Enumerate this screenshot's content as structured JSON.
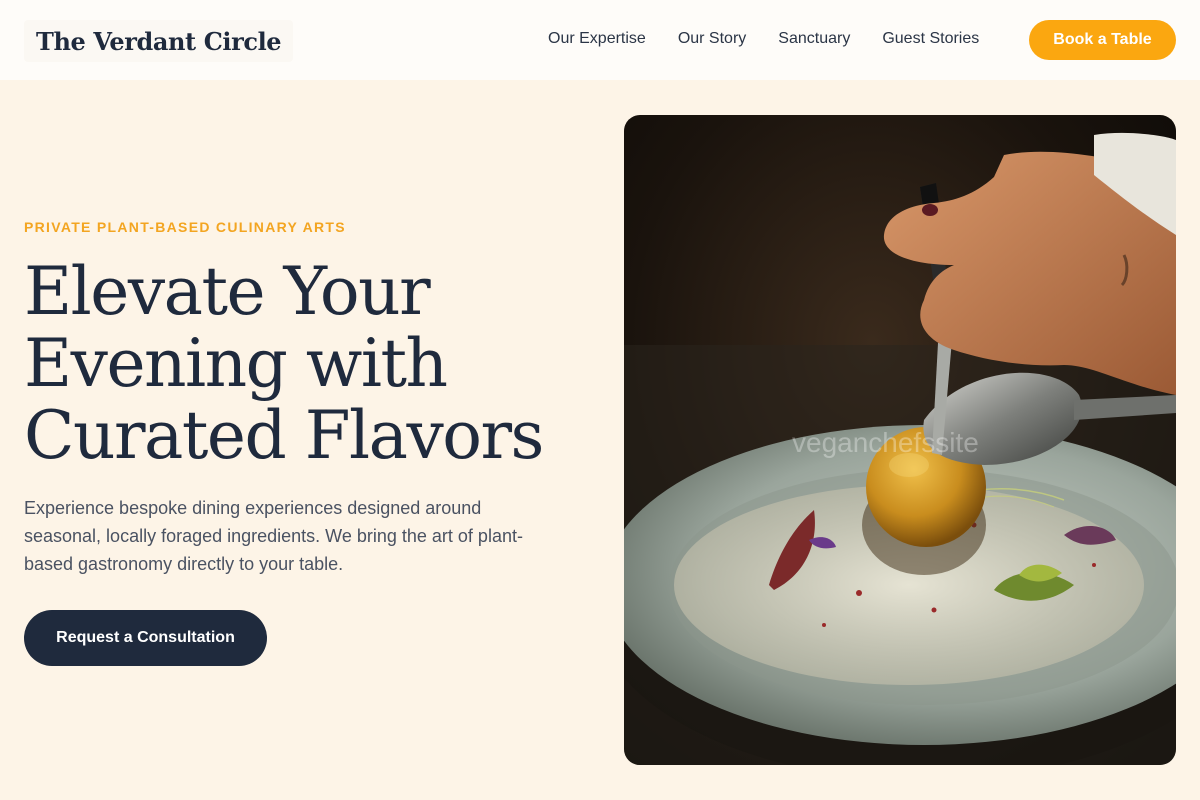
{
  "header": {
    "logo": "The Verdant Circle",
    "nav": [
      "Our Expertise",
      "Our Story",
      "Sanctuary",
      "Guest Stories"
    ],
    "cta": "Book a Table"
  },
  "hero": {
    "eyebrow": "PRIVATE PLANT-BASED CULINARY ARTS",
    "headline_lines": [
      "Elevate Your",
      "Evening with",
      "Curated Flavors"
    ],
    "lead": "Experience bespoke dining experiences designed around seasonal, locally foraged ingredients. We bring the art of plant-based gastronomy directly to your table.",
    "cta": "Request a Consultation",
    "image": {
      "subject": "chef plating a dish with spoon and tweezers",
      "watermark": "veganchefssite"
    }
  },
  "colors": {
    "accent": "#fba710",
    "eyebrow": "#f3a521",
    "navy": "#1f2a3d",
    "background": "#fdf4e7",
    "header": "#fefcf9"
  }
}
